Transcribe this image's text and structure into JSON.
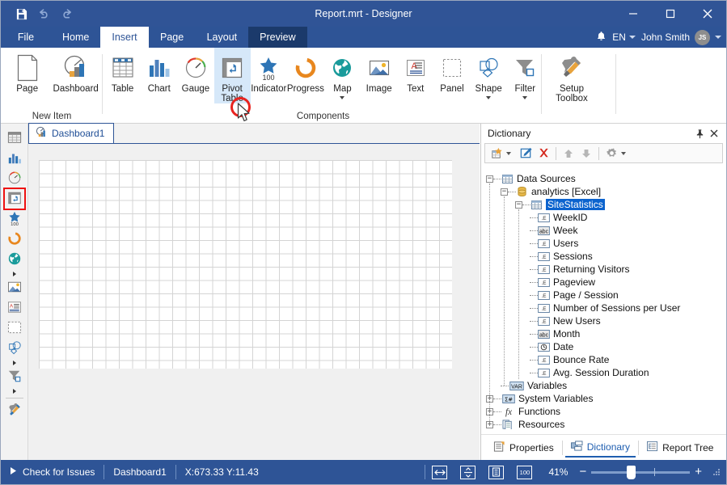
{
  "window": {
    "title": "Report.mrt - Designer",
    "quick_access": [
      {
        "name": "save-icon",
        "label": "Save"
      },
      {
        "name": "undo-icon",
        "label": "Undo"
      },
      {
        "name": "redo-icon",
        "label": "Redo"
      }
    ],
    "controls": [
      {
        "name": "minimize-button",
        "glyph": "—"
      },
      {
        "name": "maximize-button",
        "glyph": "☐"
      },
      {
        "name": "close-button",
        "glyph": "✕"
      }
    ]
  },
  "ribbon": {
    "tabs": [
      {
        "label": "File",
        "state": "normal"
      },
      {
        "label": "Home",
        "state": "normal"
      },
      {
        "label": "Insert",
        "state": "active"
      },
      {
        "label": "Page",
        "state": "normal"
      },
      {
        "label": "Layout",
        "state": "normal"
      },
      {
        "label": "Preview",
        "state": "preview"
      }
    ],
    "notifications_icon": "bell-icon",
    "language": "EN",
    "user_name": "John Smith",
    "user_initials": "JS",
    "groups": [
      {
        "label": "New Item",
        "items": [
          {
            "label": "Page",
            "icon": "page-icon",
            "selected": false,
            "dropdown": false
          },
          {
            "label": "Dashboard",
            "icon": "dashboard-icon",
            "selected": false,
            "dropdown": false
          }
        ]
      },
      {
        "label": "Components",
        "items": [
          {
            "label": "Table",
            "icon": "table-icon",
            "selected": false,
            "dropdown": false
          },
          {
            "label": "Chart",
            "icon": "chart-icon",
            "selected": false,
            "dropdown": false
          },
          {
            "label": "Gauge",
            "icon": "gauge-icon",
            "selected": false,
            "dropdown": false
          },
          {
            "label": "Pivot Table",
            "icon": "pivot-table-icon",
            "selected": true,
            "dropdown": false
          },
          {
            "label": "Indicator",
            "icon": "indicator-icon",
            "selected": false,
            "dropdown": false
          },
          {
            "label": "Progress",
            "icon": "progress-icon",
            "selected": false,
            "dropdown": false
          },
          {
            "label": "Map",
            "icon": "map-icon",
            "selected": false,
            "dropdown": true
          },
          {
            "label": "Image",
            "icon": "image-icon",
            "selected": false,
            "dropdown": false
          },
          {
            "label": "Text",
            "icon": "text-icon",
            "selected": false,
            "dropdown": false
          },
          {
            "label": "Panel",
            "icon": "panel-icon",
            "selected": false,
            "dropdown": false
          },
          {
            "label": "Shape",
            "icon": "shape-icon",
            "selected": false,
            "dropdown": true
          },
          {
            "label": "Filter",
            "icon": "filter-icon",
            "selected": false,
            "dropdown": true
          }
        ]
      },
      {
        "label": "",
        "items": [
          {
            "label": "Setup Toolbox",
            "icon": "setup-toolbox-icon",
            "selected": false,
            "dropdown": false
          }
        ]
      }
    ]
  },
  "toolbox": {
    "items": [
      {
        "name": "table-tool",
        "icon": "table-icon",
        "highlighted": false,
        "arrow": false
      },
      {
        "name": "chart-tool",
        "icon": "chart-icon",
        "highlighted": false,
        "arrow": false
      },
      {
        "name": "gauge-tool",
        "icon": "gauge-icon",
        "highlighted": false,
        "arrow": false
      },
      {
        "name": "pivot-table-tool",
        "icon": "pivot-table-icon",
        "highlighted": true,
        "arrow": false
      },
      {
        "name": "indicator-tool",
        "icon": "indicator-icon",
        "highlighted": false,
        "arrow": false
      },
      {
        "name": "progress-tool",
        "icon": "progress-icon",
        "highlighted": false,
        "arrow": false
      },
      {
        "name": "map-tool",
        "icon": "map-icon",
        "highlighted": false,
        "arrow": true
      },
      {
        "name": "image-tool",
        "icon": "image-icon",
        "highlighted": false,
        "arrow": false
      },
      {
        "name": "text-tool",
        "icon": "text-icon",
        "highlighted": false,
        "arrow": false
      },
      {
        "name": "panel-tool",
        "icon": "panel-icon",
        "highlighted": false,
        "arrow": false
      },
      {
        "name": "shape-tool",
        "icon": "shape-icon",
        "highlighted": false,
        "arrow": true
      },
      {
        "name": "filter-tool",
        "icon": "filter-icon",
        "highlighted": false,
        "arrow": true
      },
      {
        "name": "setup-toolbox-tool",
        "icon": "setup-toolbox-icon",
        "highlighted": false,
        "arrow": false
      }
    ]
  },
  "document": {
    "tab_label": "Dashboard1",
    "tab_icon": "dashboard-icon"
  },
  "dictionary": {
    "title": "Dictionary",
    "pin_icon": "pin-icon",
    "close_icon": "close-icon",
    "toolbar": [
      {
        "name": "new-item-button",
        "icon": "new-item-icon",
        "dropdown": true
      },
      {
        "name": "edit-button",
        "icon": "edit-icon",
        "dropdown": false
      },
      {
        "name": "delete-button",
        "icon": "delete-icon",
        "dropdown": false
      },
      {
        "name": "move-up-button",
        "icon": "arrow-up-icon",
        "dropdown": false
      },
      {
        "name": "move-down-button",
        "icon": "arrow-down-icon",
        "dropdown": false
      },
      {
        "name": "settings-button",
        "icon": "gear-icon",
        "dropdown": true
      }
    ],
    "tree": [
      {
        "label": "Data Sources",
        "level": 0,
        "expander": "-",
        "icon": "datasource-icon",
        "selected": false
      },
      {
        "label": "analytics [Excel]",
        "level": 1,
        "expander": "-",
        "icon": "database-icon",
        "selected": false
      },
      {
        "label": "SiteStatistics",
        "level": 2,
        "expander": "-",
        "icon": "table-icon",
        "selected": true
      },
      {
        "label": "WeekID",
        "level": 3,
        "expander": "",
        "icon": "expression-icon",
        "selected": false
      },
      {
        "label": "Week",
        "level": 3,
        "expander": "",
        "icon": "string-icon",
        "selected": false
      },
      {
        "label": "Users",
        "level": 3,
        "expander": "",
        "icon": "expression-icon",
        "selected": false
      },
      {
        "label": "Sessions",
        "level": 3,
        "expander": "",
        "icon": "expression-icon",
        "selected": false
      },
      {
        "label": "Returning Visitors",
        "level": 3,
        "expander": "",
        "icon": "expression-icon",
        "selected": false
      },
      {
        "label": "Pageview",
        "level": 3,
        "expander": "",
        "icon": "expression-icon",
        "selected": false
      },
      {
        "label": "Page / Session",
        "level": 3,
        "expander": "",
        "icon": "expression-icon",
        "selected": false
      },
      {
        "label": "Number of Sessions per User",
        "level": 3,
        "expander": "",
        "icon": "expression-icon",
        "selected": false
      },
      {
        "label": "New Users",
        "level": 3,
        "expander": "",
        "icon": "expression-icon",
        "selected": false
      },
      {
        "label": "Month",
        "level": 3,
        "expander": "",
        "icon": "string-icon",
        "selected": false
      },
      {
        "label": "Date",
        "level": 3,
        "expander": "",
        "icon": "date-icon",
        "selected": false
      },
      {
        "label": "Bounce Rate",
        "level": 3,
        "expander": "",
        "icon": "expression-icon",
        "selected": false
      },
      {
        "label": "Avg. Session Duration",
        "level": 3,
        "expander": "",
        "icon": "expression-icon",
        "selected": false
      },
      {
        "label": "Variables",
        "level": 1,
        "expander": "",
        "icon": "variables-icon",
        "selected": false
      },
      {
        "label": "System Variables",
        "level": 1,
        "expander": "+",
        "icon": "system-variables-icon",
        "selected": false
      },
      {
        "label": "Functions",
        "level": 1,
        "expander": "+",
        "icon": "functions-icon",
        "selected": false
      },
      {
        "label": "Resources",
        "level": 1,
        "expander": "+",
        "icon": "resources-icon",
        "selected": false
      }
    ],
    "tabs": [
      {
        "label": "Properties",
        "icon": "properties-icon",
        "active": false
      },
      {
        "label": "Dictionary",
        "icon": "dictionary-icon",
        "active": true
      },
      {
        "label": "Report Tree",
        "icon": "report-tree-icon",
        "active": false
      }
    ]
  },
  "statusbar": {
    "check_for_issues": "Check for Issues",
    "page_name": "Dashboard1",
    "coordinates": "X:673.33 Y:11.43",
    "view_buttons": [
      {
        "name": "fit-width-button",
        "icon": "fit-width-icon"
      },
      {
        "name": "fit-height-button",
        "icon": "fit-height-icon"
      },
      {
        "name": "page-view-button",
        "icon": "page-view-icon"
      },
      {
        "name": "actual-size-button",
        "icon": "hundred-icon",
        "label": "100"
      }
    ],
    "zoom_level": "41%",
    "zoom_out_label": "−",
    "zoom_in_label": "+"
  },
  "annotation": {
    "circle_color": "#e8231f",
    "cursor_icon": "arrow-cursor-icon"
  },
  "colors": {
    "title_bar": "#305496",
    "ribbon": "#2e5496",
    "accent": "#1f5eb0",
    "selection": "#0b63ce",
    "status_bar": "#2e5496"
  }
}
